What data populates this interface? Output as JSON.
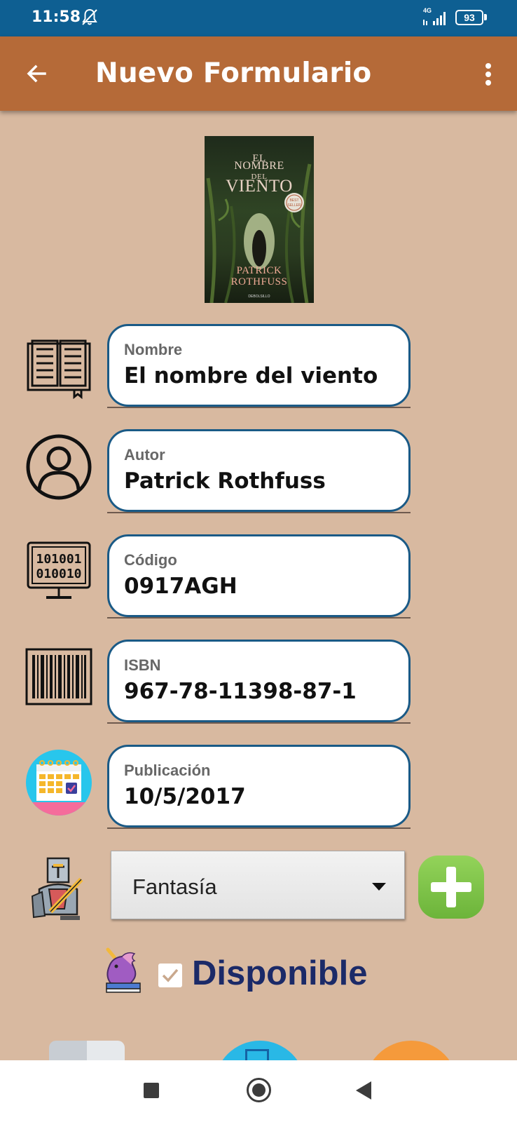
{
  "status_bar": {
    "time": "11:58",
    "network_type": "4G",
    "battery_level": "93"
  },
  "app_bar": {
    "title": "Nuevo Formulario"
  },
  "book_cover": {
    "title_line1": "EL",
    "title_line2": "NOMBRE",
    "title_line3": "DEL",
    "title_line4": "VIENTO",
    "author_line1": "PATRICK",
    "author_line2": "ROTHFUSS",
    "publisher": "DEBOLSILLO",
    "badge": "BEST SELLER"
  },
  "form": {
    "fields": [
      {
        "label": "Nombre",
        "value": "El nombre del viento",
        "icon": "open-book-icon"
      },
      {
        "label": "Autor",
        "value": "Patrick Rothfuss",
        "icon": "user-icon"
      },
      {
        "label": "Código",
        "value": "0917AGH",
        "icon": "binary-monitor-icon"
      },
      {
        "label": "ISBN",
        "value": "967-78-11398-87-1",
        "icon": "barcode-icon"
      },
      {
        "label": "Publicación",
        "value": "10/5/2017",
        "icon": "calendar-icon"
      }
    ],
    "category": {
      "selected": "Fantasía",
      "icon": "knight-icon"
    },
    "available": {
      "label": "Disponible",
      "checked": true,
      "icon": "unicorn-icon"
    }
  },
  "colors": {
    "status_bar": "#0e5f92",
    "app_bar": "#b56a38",
    "background": "#d8b9a0",
    "field_border": "#1a5a86",
    "add_button": "#7cc246",
    "available_text": "#1b2a68"
  }
}
